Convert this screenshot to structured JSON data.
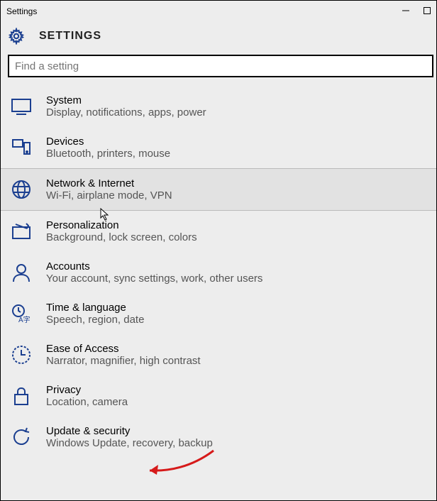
{
  "window": {
    "title": "Settings"
  },
  "header": {
    "title": "SETTINGS"
  },
  "search": {
    "placeholder": "Find a setting"
  },
  "categories": [
    {
      "id": "system",
      "title": "System",
      "desc": "Display, notifications, apps, power",
      "hovered": false
    },
    {
      "id": "devices",
      "title": "Devices",
      "desc": "Bluetooth, printers, mouse",
      "hovered": false
    },
    {
      "id": "network",
      "title": "Network & Internet",
      "desc": "Wi-Fi, airplane mode, VPN",
      "hovered": true
    },
    {
      "id": "personalization",
      "title": "Personalization",
      "desc": "Background, lock screen, colors",
      "hovered": false
    },
    {
      "id": "accounts",
      "title": "Accounts",
      "desc": "Your account, sync settings, work, other users",
      "hovered": false
    },
    {
      "id": "time",
      "title": "Time & language",
      "desc": "Speech, region, date",
      "hovered": false
    },
    {
      "id": "ease",
      "title": "Ease of Access",
      "desc": "Narrator, magnifier, high contrast",
      "hovered": false
    },
    {
      "id": "privacy",
      "title": "Privacy",
      "desc": "Location, camera",
      "hovered": false
    },
    {
      "id": "update",
      "title": "Update & security",
      "desc": "Windows Update, recovery, backup",
      "hovered": false
    }
  ],
  "colors": {
    "accent": "#1b3f90"
  }
}
